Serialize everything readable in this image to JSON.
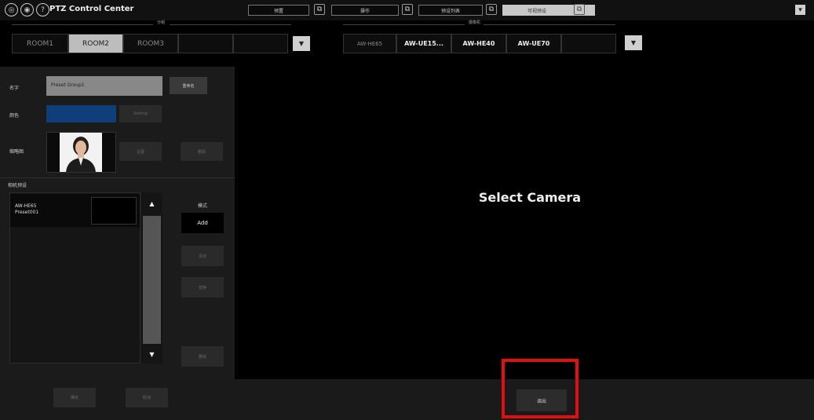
{
  "header": {
    "home_icon": "◎",
    "camera_icon": "◉",
    "help_icon": "?",
    "title": "PTZ Control Center",
    "tabs": [
      {
        "label": "预置"
      },
      {
        "label": "操作"
      },
      {
        "label": "预设列表"
      },
      {
        "label": "可视预设"
      }
    ],
    "popout_icon": "⧉",
    "menu_icon": "▾"
  },
  "room_section": {
    "label": "分组",
    "rooms": [
      "ROOM1",
      "ROOM2",
      "ROOM3"
    ],
    "dropdown_icon": "▼"
  },
  "camera_section": {
    "label": "摄像机",
    "cameras": [
      "AW-HE65",
      "AW-UE15...",
      "AW-HE40",
      "AW-UE70"
    ],
    "dropdown_icon": "▼"
  },
  "left_panel": {
    "name_label": "名字",
    "name_value": "Preset Group1",
    "name_button": "重命名",
    "color_label": "颜色",
    "color_value": "#0f3f78",
    "setting_button": "Setting",
    "thumbnail_label": "缩略图",
    "thumb_btn1": "设置",
    "thumb_btn2": "删除",
    "camera_label": "相机预设",
    "list_item_line1": "AW-HE65",
    "list_item_line2": "Preset001",
    "scroll_up": "▲",
    "scroll_down": "▼",
    "mode_label": "模式",
    "add_button": "Add",
    "btn_a": "添加",
    "btn_b": "替换",
    "btn_c": "删除"
  },
  "main": {
    "message": "Select Camera"
  },
  "footer": {
    "apply_button": "确定",
    "cancel_button": "取消",
    "select_button": "调出",
    "highlight_color": "#e01010"
  }
}
